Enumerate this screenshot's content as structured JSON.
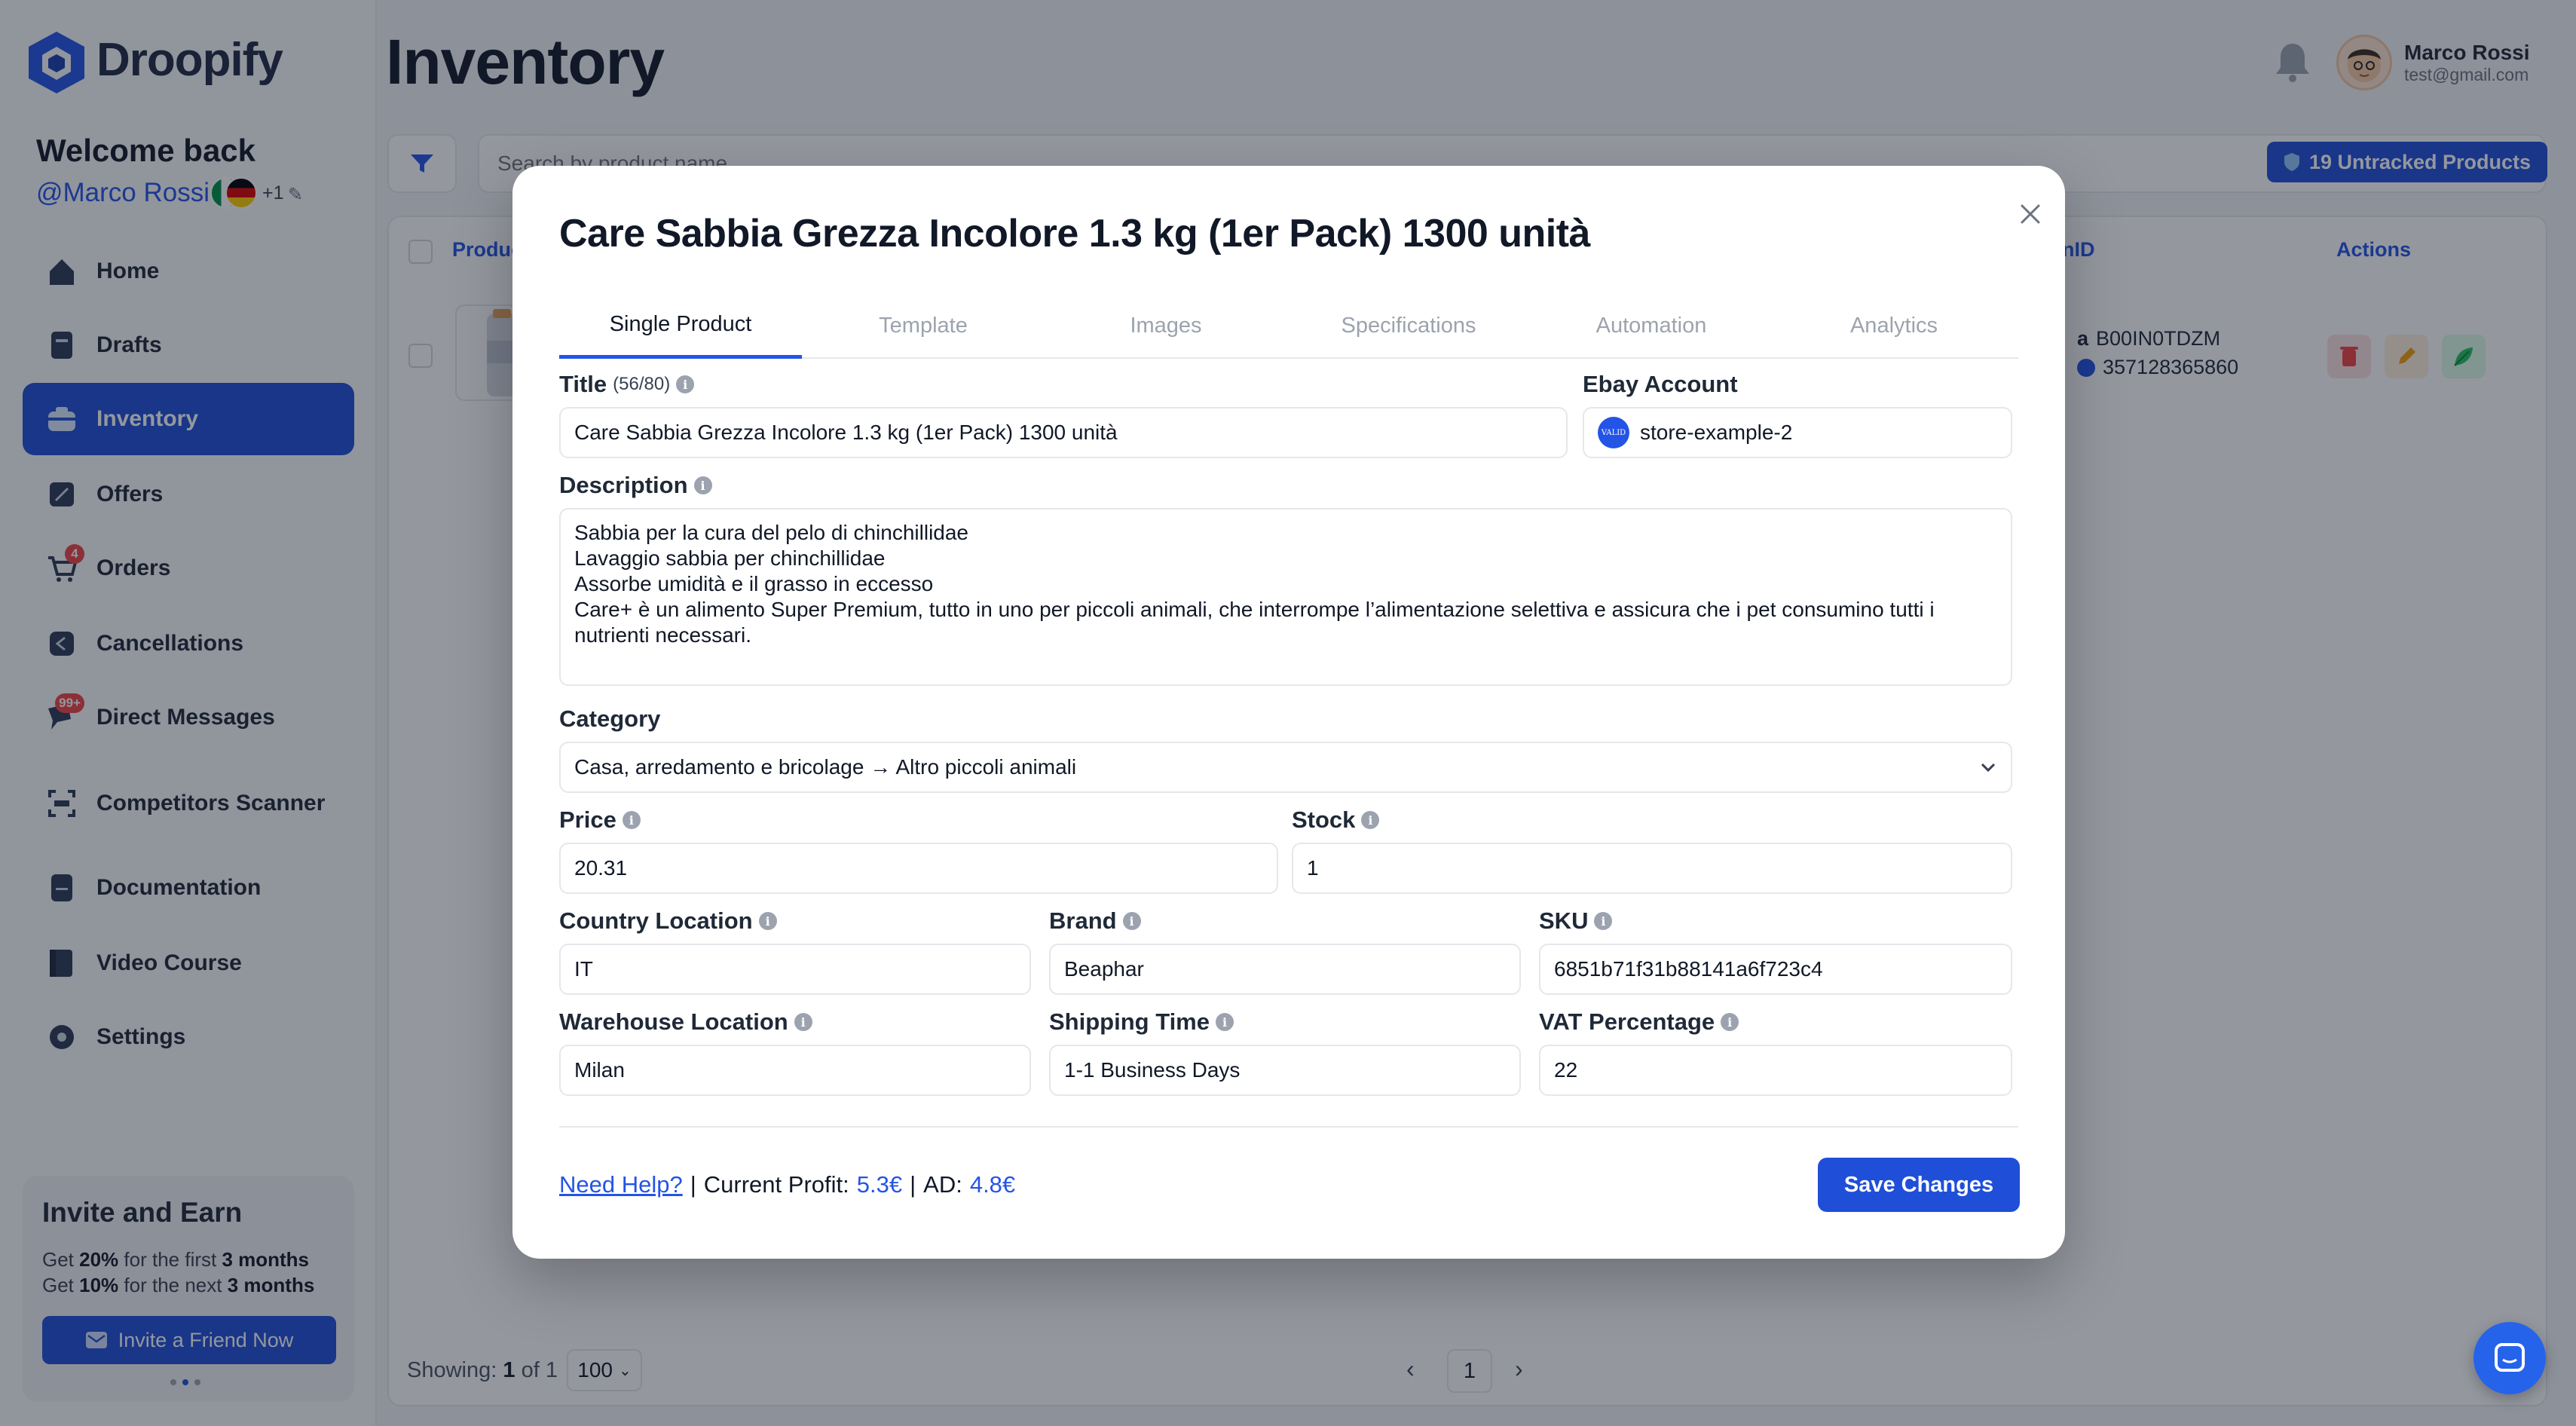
{
  "app": {
    "brand": "Droopify",
    "page_title": "Inventory"
  },
  "sidebar": {
    "welcome": "Welcome back",
    "user_handle": "@Marco Rossi",
    "more_count": "+1",
    "items": [
      {
        "label": "Home",
        "icon": "home-icon"
      },
      {
        "label": "Drafts",
        "icon": "drafts-icon"
      },
      {
        "label": "Inventory",
        "icon": "inventory-icon",
        "active": true
      },
      {
        "label": "Offers",
        "icon": "offers-icon"
      },
      {
        "label": "Orders",
        "icon": "cart-icon",
        "badge": "4"
      },
      {
        "label": "Cancellations",
        "icon": "cancellations-icon"
      },
      {
        "label": "Direct Messages",
        "icon": "messages-icon",
        "badge": "99+"
      },
      {
        "label": "Competitors Scanner",
        "icon": "scanner-icon"
      },
      {
        "label": "Documentation",
        "icon": "documentation-icon"
      },
      {
        "label": "Video Course",
        "icon": "video-course-icon"
      },
      {
        "label": "Settings",
        "icon": "settings-icon"
      }
    ],
    "invite": {
      "title": "Invite and Earn",
      "line1_pre": "Get ",
      "line1_pct": "20%",
      "line1_mid": " for the first ",
      "line1_period": "3 months",
      "line2_pre": "Get ",
      "line2_pct": "10%",
      "line2_mid": " for the next ",
      "line2_period": "3 months",
      "button": "Invite a Friend Now"
    }
  },
  "header": {
    "user_name": "Marco Rossi",
    "user_email": "test@gmail.com"
  },
  "toolbar": {
    "search_placeholder": "Search by product name...",
    "untracked_label": "19 Untracked Products"
  },
  "table": {
    "columns": {
      "product": "Produc",
      "asin": "nID",
      "actions": "Actions"
    },
    "row": {
      "asin": "B00IN0TDZM",
      "ebay_id": "357128365860"
    }
  },
  "footer": {
    "showing_label": "Showing:",
    "showing_from": "1",
    "showing_of": "of",
    "showing_total": "1",
    "per_page": "100",
    "current_page": "1"
  },
  "modal": {
    "title": "Care Sabbia Grezza Incolore 1.3 kg (1er Pack) 1300 unità",
    "tabs": [
      "Single Product",
      "Template",
      "Images",
      "Specifications",
      "Automation",
      "Analytics"
    ],
    "active_tab": "Single Product",
    "fields": {
      "title_label": "Title",
      "title_count": "(56/80)",
      "title_value": "Care Sabbia Grezza Incolore 1.3 kg (1er Pack) 1300 unità",
      "account_label": "Ebay Account",
      "account_avatar": "VALID",
      "account_value": "store-example-2",
      "description_label": "Description",
      "description_value": "Sabbia per la cura del pelo di chinchillidae\nLavaggio sabbia per chinchillidae\nAssorbe umidità e il grasso in eccesso\nCare+ è un alimento Super Premium, tutto in uno per piccoli animali, che interrompe l’alimentazione selettiva e assicura che i pet consumino tutti i nutrienti necessari.",
      "category_label": "Category",
      "category_value": "Casa, arredamento e bricolage → Altro piccoli animali",
      "price_label": "Price",
      "price_value": "20.31",
      "stock_label": "Stock",
      "stock_value": "1",
      "country_label": "Country Location",
      "country_value": "IT",
      "brand_label": "Brand",
      "brand_value": "Beaphar",
      "sku_label": "SKU",
      "sku_value": "6851b71f31b88141a6f723c4",
      "warehouse_label": "Warehouse Location",
      "warehouse_value": "Milan",
      "shipping_label": "Shipping Time",
      "shipping_value": "1-1 Business Days",
      "vat_label": "VAT Percentage",
      "vat_value": "22"
    },
    "footer": {
      "help": "Need Help?",
      "separator": "|",
      "profit_label": "Current Profit:",
      "profit_value": "5.3€",
      "ad_label": "AD:",
      "ad_value": "4.8€",
      "save": "Save Changes"
    }
  },
  "colors": {
    "accent": "#1f4fd8",
    "link": "#2454e6",
    "badge": "#ef4444"
  }
}
